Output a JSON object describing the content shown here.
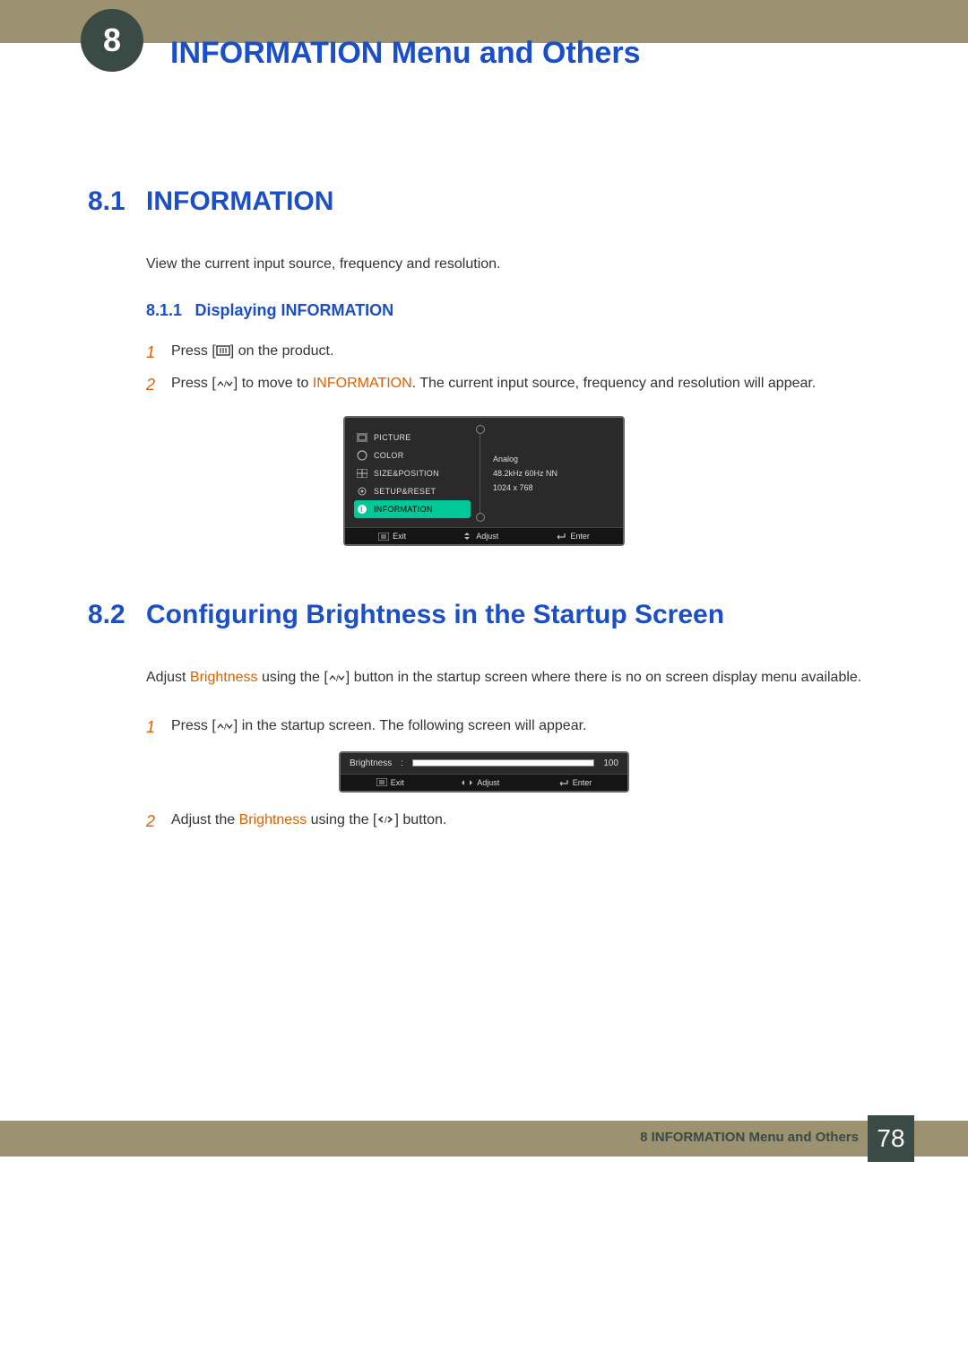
{
  "chapter_number": "8",
  "page_title": "INFORMATION Menu and Others",
  "section1": {
    "num": "8.1",
    "title": "INFORMATION",
    "intro": "View the current input source, frequency and resolution.",
    "sub": {
      "num": "8.1.1",
      "title": "Displaying INFORMATION"
    },
    "steps": {
      "s1": {
        "num": "1",
        "a": "Press [",
        "b": "] on the product."
      },
      "s2": {
        "num": "2",
        "a": "Press [",
        "b": "] to move to ",
        "hl": "INFORMATION",
        "c": ". The current input source, frequency and resolution will appear."
      }
    }
  },
  "osd": {
    "items": [
      "PICTURE",
      "COLOR",
      "SIZE&POSITION",
      "SETUP&RESET",
      "INFORMATION"
    ],
    "info": {
      "line1": "Analog",
      "line2": "48.2kHz 60Hz NN",
      "line3": "1024 x 768"
    },
    "footer": {
      "exit": "Exit",
      "adjust": "Adjust",
      "enter": "Enter"
    }
  },
  "section2": {
    "num": "8.2",
    "title": "Configuring Brightness in the Startup Screen",
    "intro": {
      "a": "Adjust ",
      "hl": "Brightness",
      "b": " using the [",
      "c": "] button in the startup screen where there is no on screen display menu available."
    },
    "steps": {
      "s1": {
        "num": "1",
        "a": "Press [",
        "b": "] in the startup screen. The following screen will appear."
      },
      "s2": {
        "num": "2",
        "a": "Adjust the ",
        "hl": "Brightness",
        "b": " using the [",
        "c": "] button."
      }
    }
  },
  "brightness": {
    "label": "Brightness",
    "value": "100"
  },
  "footer": {
    "label": "8 INFORMATION Menu and Others",
    "page": "78"
  }
}
